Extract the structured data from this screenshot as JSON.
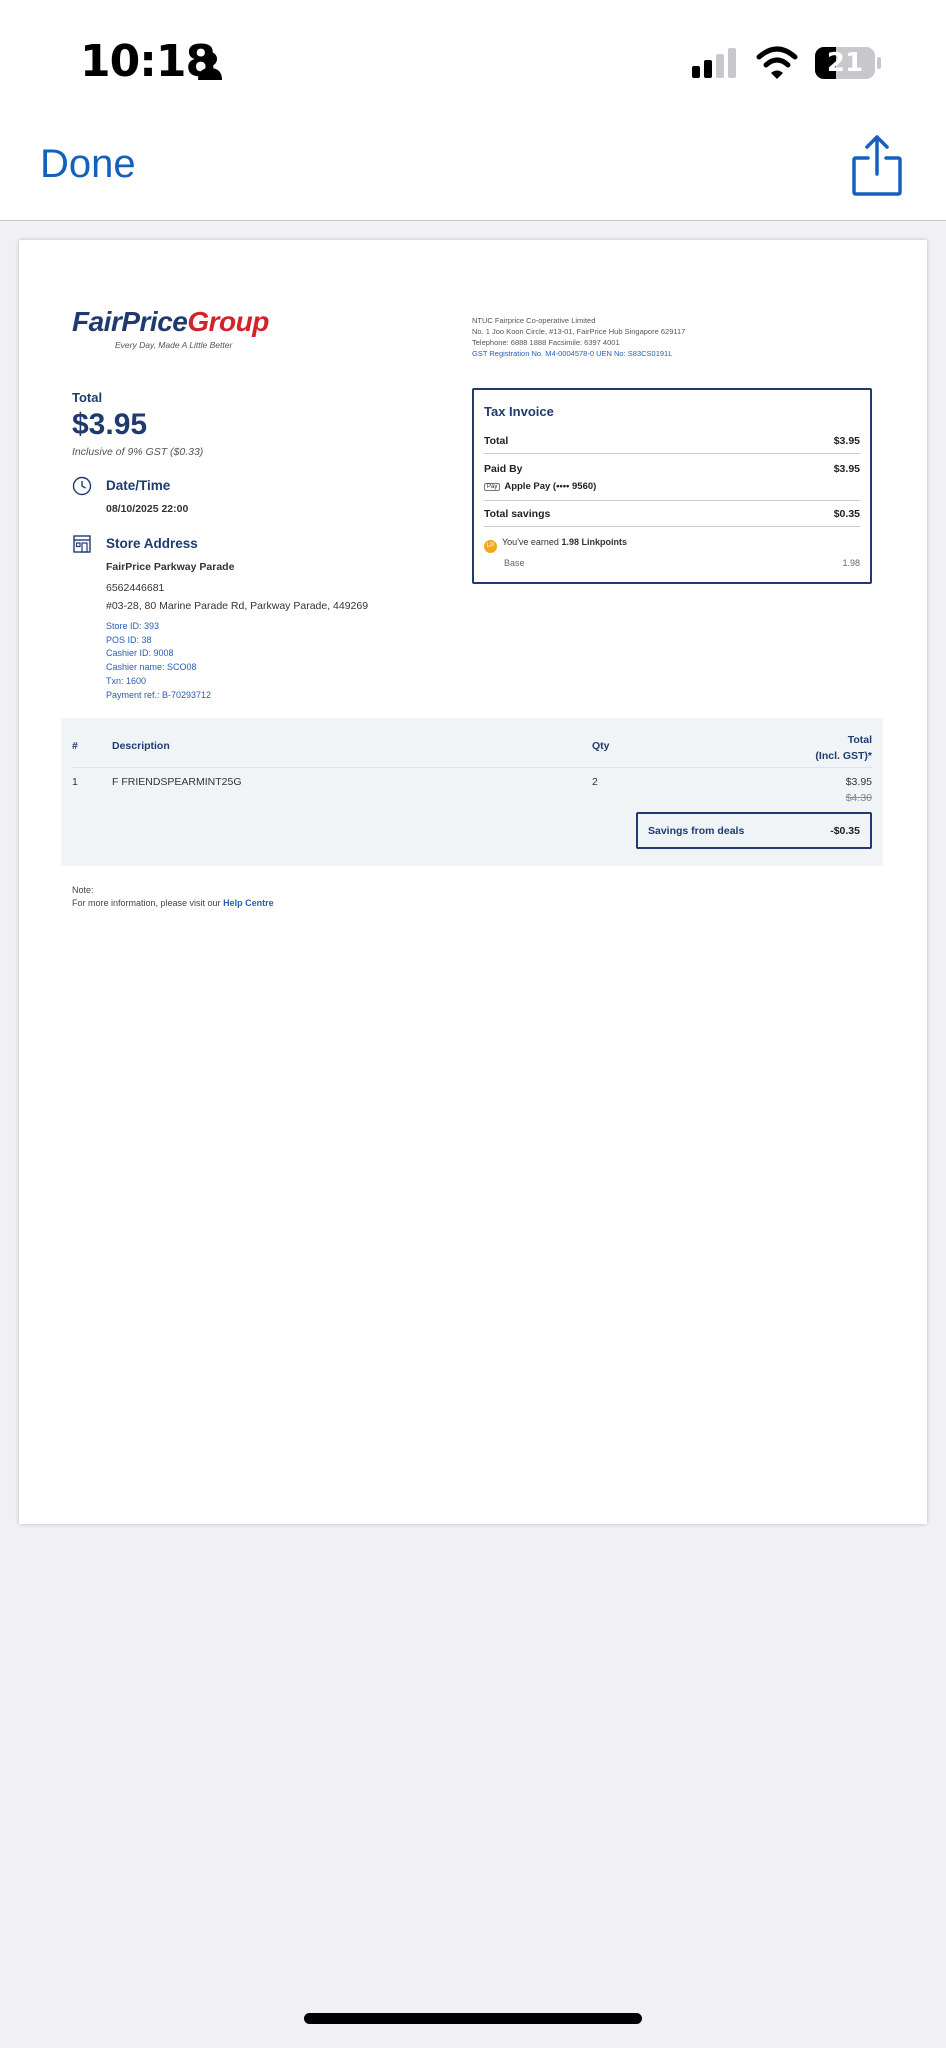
{
  "status_bar": {
    "time": "10:18",
    "battery": "21"
  },
  "nav": {
    "done_label": "Done"
  },
  "receipt": {
    "logo": {
      "part1": "FairPrice",
      "part2": "Group",
      "tagline": "Every Day, Made A Little Better"
    },
    "company": {
      "name": "NTUC Fairprice Co-operative Limited",
      "address": "No. 1 Joo Koon Circle, #13-01, FairPrice Hub Singapore 629117",
      "contact": "Telephone: 6888 1888 Facsimile: 6397 4001",
      "registration": "GST Registration No. M4-0004578-0     UEN No: S83CS0191L"
    },
    "total_label": "Total",
    "total_amount": "$3.95",
    "gst_note": "Inclusive of 9% GST ($0.33)",
    "datetime": {
      "title": "Date/Time",
      "value": "08/10/2025  22:00"
    },
    "store": {
      "title": "Store Address",
      "name": "FairPrice Parkway Parade",
      "phone": "6562446681",
      "address": "#03-28, 80 Marine Parade Rd, Parkway Parade, 449269",
      "store_id": "Store ID: 393",
      "pos_id": "POS ID: 38",
      "cashier_id": "Cashier ID: 9008",
      "cashier_name": "Cashier name: SCO08",
      "txn": "Txn: 1600",
      "payment_ref": "Payment ref.: B-70293712"
    },
    "tax_invoice": {
      "title": "Tax Invoice",
      "total_label": "Total",
      "total_value": "$3.95",
      "paid_by_label": "Paid By",
      "paid_by_value": "$3.95",
      "apple_pay_badge": "Pay",
      "payment_method": "Apple Pay (•••• 9560)",
      "savings_label": "Total savings",
      "savings_value": "$0.35",
      "linkpoints_coin": "LP",
      "linkpoints_prefix": "You've earned ",
      "linkpoints_value": "1.98 Linkpoints",
      "base_label": "Base",
      "base_value": "1.98"
    },
    "items": {
      "headers": {
        "num": "#",
        "desc": "Description",
        "qty": "Qty",
        "total_line1": "Total",
        "total_line2": "(Incl. GST)*"
      },
      "rows": [
        {
          "num": "1",
          "desc": "F FRIENDSPEARMINT25G",
          "qty": "2",
          "price": "$3.95",
          "original": "$4.30"
        }
      ],
      "savings_label": "Savings from deals",
      "savings_value": "-$0.35"
    },
    "note": {
      "label": "Note:",
      "text": "For more information, please visit our ",
      "link": "Help Centre"
    }
  }
}
